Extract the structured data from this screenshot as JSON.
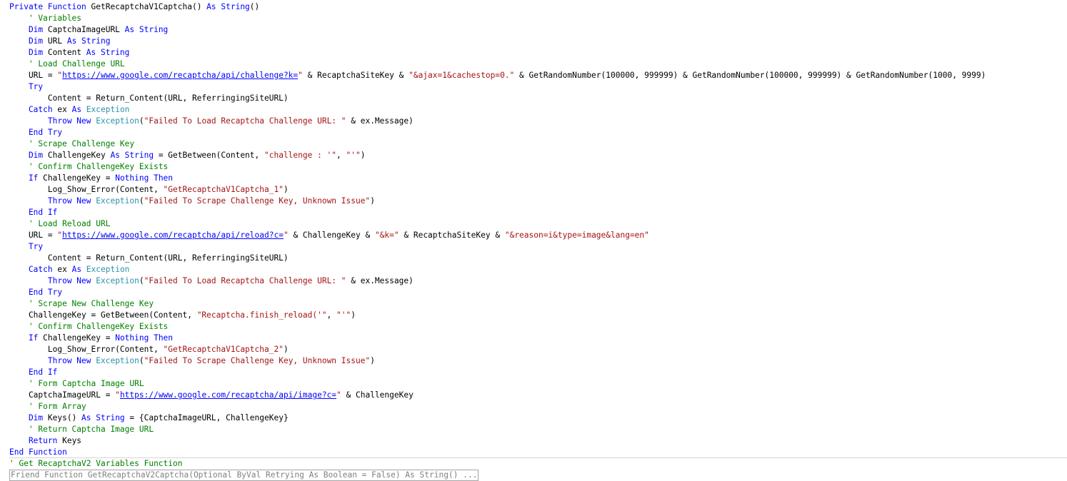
{
  "editor": {
    "colors": {
      "keyword": "#0000ff",
      "comment": "#008000",
      "string": "#a31515",
      "type": "#2b91af",
      "link": "#0000ff",
      "collapsed_text": "#808080",
      "separator": "#d6d6d6"
    },
    "lines": [
      [
        {
          "t": "kw",
          "v": "Private Function "
        },
        {
          "t": "id",
          "v": "GetRecaptchaV1Captcha() "
        },
        {
          "t": "kw",
          "v": "As String"
        },
        {
          "t": "id",
          "v": "()"
        }
      ],
      [
        {
          "t": "cm",
          "v": "    ' Variables"
        }
      ],
      [
        {
          "t": "kw",
          "v": "    Dim "
        },
        {
          "t": "id",
          "v": "CaptchaImageURL "
        },
        {
          "t": "kw",
          "v": "As String"
        }
      ],
      [
        {
          "t": "kw",
          "v": "    Dim "
        },
        {
          "t": "id",
          "v": "URL "
        },
        {
          "t": "kw",
          "v": "As String"
        }
      ],
      [
        {
          "t": "kw",
          "v": "    Dim "
        },
        {
          "t": "id",
          "v": "Content "
        },
        {
          "t": "kw",
          "v": "As String"
        }
      ],
      [
        {
          "t": "cm",
          "v": "    ' Load Challenge URL"
        }
      ],
      [
        {
          "t": "id",
          "v": "    URL = "
        },
        {
          "t": "str",
          "v": "\""
        },
        {
          "t": "url",
          "v": "https://www.google.com/recaptcha/api/challenge?k="
        },
        {
          "t": "str",
          "v": "\""
        },
        {
          "t": "id",
          "v": " & RecaptchaSiteKey & "
        },
        {
          "t": "str",
          "v": "\"&ajax=1&cachestop=0.\""
        },
        {
          "t": "id",
          "v": " & GetRandomNumber(100000, 999999) & GetRandomNumber(100000, 999999) & GetRandomNumber(1000, 9999)"
        }
      ],
      [
        {
          "t": "kw",
          "v": "    Try"
        }
      ],
      [
        {
          "t": "id",
          "v": "        Content = Return_Content(URL, ReferringingSiteURL)"
        }
      ],
      [
        {
          "t": "kw",
          "v": "    Catch "
        },
        {
          "t": "id",
          "v": "ex "
        },
        {
          "t": "kw",
          "v": "As "
        },
        {
          "t": "type",
          "v": "Exception"
        }
      ],
      [
        {
          "t": "kw",
          "v": "        Throw New "
        },
        {
          "t": "type",
          "v": "Exception"
        },
        {
          "t": "id",
          "v": "("
        },
        {
          "t": "str",
          "v": "\"Failed To Load Recaptcha Challenge URL: \""
        },
        {
          "t": "id",
          "v": " & ex.Message)"
        }
      ],
      [
        {
          "t": "kw",
          "v": "    End Try"
        }
      ],
      [
        {
          "t": "cm",
          "v": "    ' Scrape Challenge Key"
        }
      ],
      [
        {
          "t": "kw",
          "v": "    Dim "
        },
        {
          "t": "id",
          "v": "ChallengeKey "
        },
        {
          "t": "kw",
          "v": "As String"
        },
        {
          "t": "id",
          "v": " = GetBetween(Content, "
        },
        {
          "t": "str",
          "v": "\"challenge : '\""
        },
        {
          "t": "id",
          "v": ", "
        },
        {
          "t": "str",
          "v": "\"'\""
        },
        {
          "t": "id",
          "v": ")"
        }
      ],
      [
        {
          "t": "cm",
          "v": "    ' Confirm ChallengeKey Exists"
        }
      ],
      [
        {
          "t": "kw",
          "v": "    If "
        },
        {
          "t": "id",
          "v": "ChallengeKey = "
        },
        {
          "t": "kw",
          "v": "Nothing Then"
        }
      ],
      [
        {
          "t": "id",
          "v": "        Log_Show_Error(Content, "
        },
        {
          "t": "str",
          "v": "\"GetRecaptchaV1Captcha_1\""
        },
        {
          "t": "id",
          "v": ")"
        }
      ],
      [
        {
          "t": "kw",
          "v": "        Throw New "
        },
        {
          "t": "type",
          "v": "Exception"
        },
        {
          "t": "id",
          "v": "("
        },
        {
          "t": "str",
          "v": "\"Failed To Scrape Challenge Key, Unknown Issue\""
        },
        {
          "t": "id",
          "v": ")"
        }
      ],
      [
        {
          "t": "kw",
          "v": "    End If"
        }
      ],
      [
        {
          "t": "cm",
          "v": "    ' Load Reload URL"
        }
      ],
      [
        {
          "t": "id",
          "v": "    URL = "
        },
        {
          "t": "str",
          "v": "\""
        },
        {
          "t": "url",
          "v": "https://www.google.com/recaptcha/api/reload?c="
        },
        {
          "t": "str",
          "v": "\""
        },
        {
          "t": "id",
          "v": " & ChallengeKey & "
        },
        {
          "t": "str",
          "v": "\"&k=\""
        },
        {
          "t": "id",
          "v": " & RecaptchaSiteKey & "
        },
        {
          "t": "str",
          "v": "\"&reason=i&type=image&lang=en\""
        }
      ],
      [
        {
          "t": "kw",
          "v": "    Try"
        }
      ],
      [
        {
          "t": "id",
          "v": "        Content = Return_Content(URL, ReferringingSiteURL)"
        }
      ],
      [
        {
          "t": "kw",
          "v": "    Catch "
        },
        {
          "t": "id",
          "v": "ex "
        },
        {
          "t": "kw",
          "v": "As "
        },
        {
          "t": "type",
          "v": "Exception"
        }
      ],
      [
        {
          "t": "kw",
          "v": "        Throw New "
        },
        {
          "t": "type",
          "v": "Exception"
        },
        {
          "t": "id",
          "v": "("
        },
        {
          "t": "str",
          "v": "\"Failed To Load Recaptcha Challenge URL: \""
        },
        {
          "t": "id",
          "v": " & ex.Message)"
        }
      ],
      [
        {
          "t": "kw",
          "v": "    End Try"
        }
      ],
      [
        {
          "t": "cm",
          "v": "    ' Scrape New Challenge Key"
        }
      ],
      [
        {
          "t": "id",
          "v": "    ChallengeKey = GetBetween(Content, "
        },
        {
          "t": "str",
          "v": "\"Recaptcha.finish_reload('\""
        },
        {
          "t": "id",
          "v": ", "
        },
        {
          "t": "str",
          "v": "\"'\""
        },
        {
          "t": "id",
          "v": ")"
        }
      ],
      [
        {
          "t": "cm",
          "v": "    ' Confirm ChallengeKey Exists"
        }
      ],
      [
        {
          "t": "kw",
          "v": "    If "
        },
        {
          "t": "id",
          "v": "ChallengeKey = "
        },
        {
          "t": "kw",
          "v": "Nothing Then"
        }
      ],
      [
        {
          "t": "id",
          "v": "        Log_Show_Error(Content, "
        },
        {
          "t": "str",
          "v": "\"GetRecaptchaV1Captcha_2\""
        },
        {
          "t": "id",
          "v": ")"
        }
      ],
      [
        {
          "t": "kw",
          "v": "        Throw New "
        },
        {
          "t": "type",
          "v": "Exception"
        },
        {
          "t": "id",
          "v": "("
        },
        {
          "t": "str",
          "v": "\"Failed To Scrape Challenge Key, Unknown Issue\""
        },
        {
          "t": "id",
          "v": ")"
        }
      ],
      [
        {
          "t": "kw",
          "v": "    End If"
        }
      ],
      [
        {
          "t": "cm",
          "v": "    ' Form Captcha Image URL"
        }
      ],
      [
        {
          "t": "id",
          "v": "    CaptchaImageURL = "
        },
        {
          "t": "str",
          "v": "\""
        },
        {
          "t": "url",
          "v": "https://www.google.com/recaptcha/api/image?c="
        },
        {
          "t": "str",
          "v": "\""
        },
        {
          "t": "id",
          "v": " & ChallengeKey"
        }
      ],
      [
        {
          "t": "cm",
          "v": "    ' Form Array"
        }
      ],
      [
        {
          "t": "kw",
          "v": "    Dim "
        },
        {
          "t": "id",
          "v": "Keys() "
        },
        {
          "t": "kw",
          "v": "As String"
        },
        {
          "t": "id",
          "v": " = {CaptchaImageURL, ChallengeKey}"
        }
      ],
      [
        {
          "t": "cm",
          "v": "    ' Return Captcha Image URL"
        }
      ],
      [
        {
          "t": "kw",
          "v": "    Return "
        },
        {
          "t": "id",
          "v": "Keys"
        }
      ],
      [
        {
          "t": "kw",
          "v": "End Function"
        }
      ],
      [
        {
          "t": "cm",
          "v": "' Get RecaptchaV2 Variables Function"
        }
      ]
    ],
    "collapsed_block": "Friend Function GetRecaptchaV2Captcha(Optional ByVal Retrying As Boolean = False) As String() ..."
  }
}
